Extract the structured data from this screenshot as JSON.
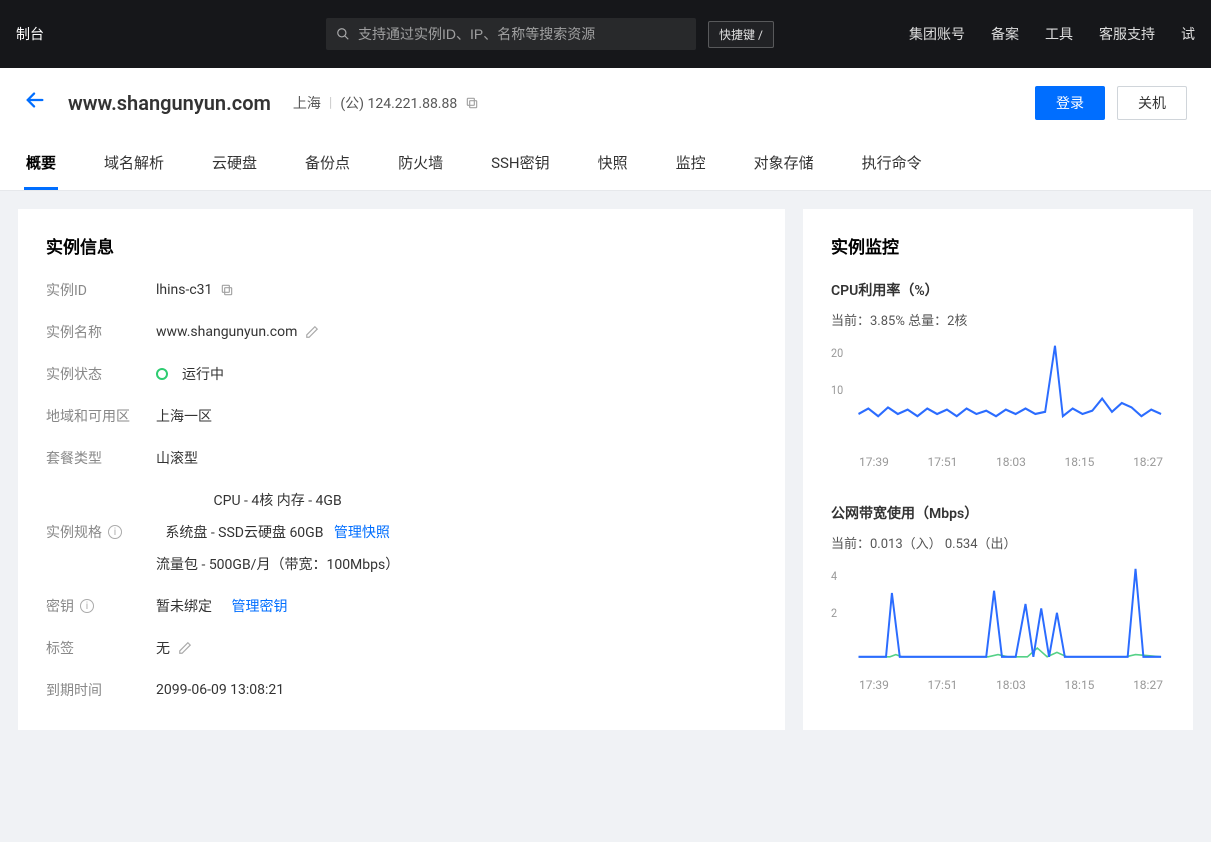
{
  "topbar": {
    "left_label": "制台",
    "search_placeholder": "支持通过实例ID、IP、名称等搜索资源",
    "shortcut_label": "快捷键 /",
    "links": [
      "集团账号",
      "备案",
      "工具",
      "客服支持",
      "试"
    ]
  },
  "header": {
    "title": "www.shangunyun.com",
    "region": "上海",
    "ip_label": "(公) 124.221.88.88",
    "btn_login": "登录",
    "btn_shutdown": "关机"
  },
  "tabs": [
    "概要",
    "域名解析",
    "云硬盘",
    "备份点",
    "防火墙",
    "SSH密钥",
    "快照",
    "监控",
    "对象存储",
    "执行命令"
  ],
  "info": {
    "panel_title": "实例信息",
    "rows": {
      "id": {
        "label": "实例ID",
        "value": "lhins-c31"
      },
      "name": {
        "label": "实例名称",
        "value": "www.shangunyun.com"
      },
      "status": {
        "label": "实例状态",
        "value": "运行中"
      },
      "zone": {
        "label": "地域和可用区",
        "value": "上海一区"
      },
      "package": {
        "label": "套餐类型",
        "value": "山滚型"
      },
      "spec": {
        "label": "实例规格",
        "line1": "CPU - 4核 内存 - 4GB",
        "line2_prefix": "系统盘 - SSD云硬盘 60GB",
        "line2_link": "管理快照",
        "line3": "流量包 - 500GB/月（带宽：100Mbps）"
      },
      "key": {
        "label": "密钥",
        "value": "暂未绑定",
        "link": "管理密钥"
      },
      "tag": {
        "label": "标签",
        "value": "无"
      },
      "expire": {
        "label": "到期时间",
        "value": "2099-06-09 13:08:21"
      }
    }
  },
  "monitor": {
    "panel_title": "实例监控",
    "cpu": {
      "title": "CPU利用率（%）",
      "subtitle": "当前：3.85% 总量：2核",
      "y_ticks": [
        "20",
        "10"
      ],
      "x_ticks": [
        "17:39",
        "17:51",
        "18:03",
        "18:15",
        "18:27"
      ]
    },
    "bw": {
      "title": "公网带宽使用（Mbps）",
      "subtitle": "当前：0.013（入） 0.534（出）",
      "y_ticks": [
        "4",
        "2"
      ],
      "x_ticks": [
        "17:39",
        "17:51",
        "18:03",
        "18:15",
        "18:27"
      ]
    }
  },
  "chart_data": [
    {
      "type": "line",
      "title": "CPU利用率（%）",
      "xlabel": "",
      "ylabel": "%",
      "ylim": [
        0,
        25
      ],
      "x": [
        "17:39",
        "17:51",
        "18:03",
        "18:15",
        "18:27"
      ],
      "series": [
        {
          "name": "CPU",
          "values": [
            5,
            6,
            5,
            6,
            7,
            5,
            6,
            5,
            6,
            5,
            6,
            5,
            6,
            5,
            6,
            6,
            5,
            6,
            5,
            6,
            5,
            6,
            5,
            20,
            5,
            6,
            5,
            6,
            9,
            6,
            8,
            7,
            5,
            6
          ]
        }
      ]
    },
    {
      "type": "line",
      "title": "公网带宽使用（Mbps）",
      "xlabel": "",
      "ylabel": "Mbps",
      "ylim": [
        0,
        5
      ],
      "x": [
        "17:39",
        "17:51",
        "18:03",
        "18:15",
        "18:27"
      ],
      "series": [
        {
          "name": "出",
          "values": [
            0.1,
            0.2,
            0.2,
            3.0,
            0.2,
            0.1,
            0.2,
            0.1,
            0.2,
            0.1,
            0.2,
            0.1,
            3.2,
            0.2,
            0.1,
            0.2,
            2.6,
            0.2,
            2.4,
            0.2,
            2.2,
            0.2,
            0.1,
            0.2,
            0.1,
            0.2,
            0.1,
            4.2,
            0.2,
            0.1
          ]
        },
        {
          "name": "入",
          "values": [
            0.01,
            0.02,
            0.03,
            0.05,
            0.02,
            0.01,
            0.02,
            0.01,
            0.02,
            0.01,
            0.02,
            0.01,
            0.05,
            0.02,
            0.01,
            0.02,
            0.05,
            0.02,
            0.6,
            0.02,
            0.4,
            0.02,
            0.01,
            0.02,
            0.01,
            0.02,
            0.01,
            0.06,
            0.02,
            0.01
          ]
        }
      ]
    }
  ]
}
